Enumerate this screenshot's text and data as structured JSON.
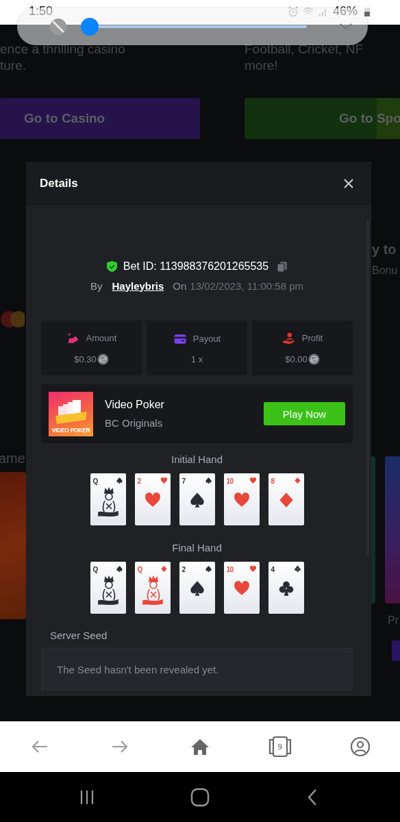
{
  "status_bar": {
    "time": "1:50",
    "battery": "46%"
  },
  "brightness": {
    "level": 0
  },
  "background": {
    "left_lines": [
      "ence a thrilling casino",
      "ture."
    ],
    "left_button": "Go to Casino",
    "right_lines": [
      "Football, Cricket, NF",
      "more!"
    ],
    "right_button": "Go to Spo",
    "right_heading": "y to",
    "right_sub": "Bonu",
    "left_heading": "ame",
    "right_label": "Pr"
  },
  "modal": {
    "title": "Details",
    "bet_id": "Bet ID: 113988376201265535",
    "by_label": "By",
    "user": "Hayleybris",
    "on_label": "On",
    "date": "13/02/2023, 11:00:58 pm",
    "stats": [
      {
        "kind": "amount",
        "label": "Amount",
        "value": "$0.30",
        "coin": true
      },
      {
        "kind": "payout",
        "label": "Payout",
        "value": "1 x",
        "coin": false
      },
      {
        "kind": "profit",
        "label": "Profit",
        "value": "$0.00",
        "coin": true
      }
    ],
    "game": {
      "name": "Video Poker",
      "provider": "BC Originals",
      "thumb_label": "VIDEO POKER",
      "button": "Play Now"
    },
    "hands": [
      {
        "title": "Initial Hand",
        "cards": [
          {
            "rank": "Q",
            "kind": "spade",
            "face": true
          },
          {
            "rank": "2",
            "kind": "heart",
            "face": false
          },
          {
            "rank": "7",
            "kind": "spade",
            "face": false
          },
          {
            "rank": "10",
            "kind": "heart",
            "face": false
          },
          {
            "rank": "8",
            "kind": "diamond",
            "face": false
          }
        ]
      },
      {
        "title": "Final Hand",
        "cards": [
          {
            "rank": "Q",
            "kind": "spade",
            "face": true
          },
          {
            "rank": "Q",
            "kind": "diamond",
            "face": true
          },
          {
            "rank": "2",
            "kind": "spade",
            "face": false
          },
          {
            "rank": "10",
            "kind": "heart",
            "face": false
          },
          {
            "rank": "4",
            "kind": "club",
            "face": false
          }
        ]
      }
    ],
    "server_seed": {
      "label": "Server Seed",
      "value": "The Seed hasn't been revealed yet."
    }
  },
  "browser_nav": {
    "tab_count": "9"
  }
}
